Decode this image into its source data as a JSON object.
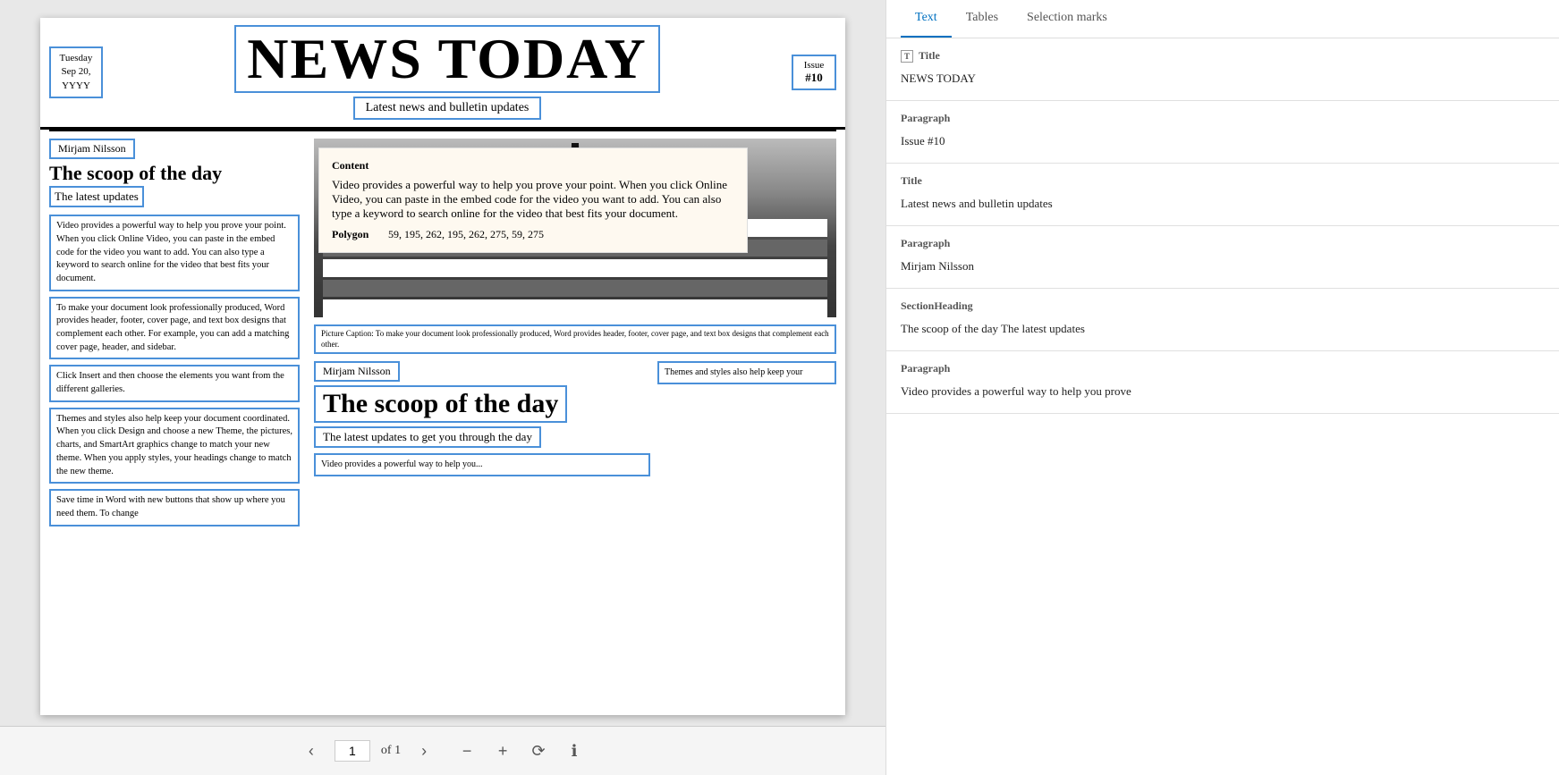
{
  "viewer": {
    "newspaper": {
      "date": "Tuesday\nSep 20,\nYYYY",
      "title": "NEWS TODAY",
      "subtitle": "Latest news and bulletin updates",
      "issue_label": "Issue",
      "issue_num": "#10"
    },
    "left_col": {
      "author": "Mirjam Nilsson",
      "heading": "The scoop of the day",
      "subheading": "The latest updates",
      "paragraphs": [
        "Video provides a powerful way to help you prove your point. When you click Online Video, you can paste in the embed code for the video you want to add. You can also type a keyword to search online for the video that best fits your document.",
        "To make your document look professionally produced, Word provides header, footer, cover page, and text box designs that complement each other. For example, you can add a matching cover page, header, and sidebar.",
        "Click Insert and then choose the elements you want from the different galleries.",
        "Themes and styles also help keep your document coordinated. When you click Design and choose a new Theme, the pictures, charts, and SmartArt graphics change to match your new theme. When you apply styles, your headings change to match the new theme.",
        "Save time in Word with new buttons that show up where you need them. To change"
      ]
    },
    "tooltip": {
      "label": "Content",
      "content": "Video provides a powerful way to help you prove your point. When you click Online Video, you can paste in the embed code for the video you want to add. You can also type a keyword to search online for the video that best fits your document.",
      "polygon_label": "Polygon",
      "polygon_value": "59, 195, 262, 195, 262, 275, 59, 275"
    },
    "picture_caption": "Picture Caption: To make your document look professionally produced, Word provides header, footer, cover page, and text box designs that complement each other.",
    "second_section": {
      "author": "Mirjam Nilsson",
      "heading": "The scoop of the day",
      "subheading": "The latest updates to get you through the day",
      "content_preview": "Video provides a powerful way to help you...",
      "right_preview": "Themes and styles also help keep your"
    }
  },
  "toolbar": {
    "prev_label": "‹",
    "next_label": "›",
    "page_num": "1",
    "page_of": "of 1",
    "zoom_out": "−",
    "zoom_in": "+",
    "rotate": "⟳",
    "info": "ℹ"
  },
  "right_panel": {
    "tabs": [
      {
        "id": "text",
        "label": "Text",
        "active": true
      },
      {
        "id": "tables",
        "label": "Tables",
        "active": false
      },
      {
        "id": "selection_marks",
        "label": "Selection marks",
        "active": false
      }
    ],
    "sections": [
      {
        "type": "Title",
        "label": "Title",
        "value": "NEWS TODAY"
      },
      {
        "type": "Paragraph",
        "label": "Paragraph",
        "value": "Issue #10"
      },
      {
        "type": "Title",
        "label": "Title",
        "value": "Latest news and bulletin updates"
      },
      {
        "type": "Paragraph",
        "label": "Paragraph",
        "value": "Mirjam Nilsson"
      },
      {
        "type": "SectionHeading",
        "label": "SectionHeading",
        "value": "The scoop of the day The latest updates"
      },
      {
        "type": "Paragraph",
        "label": "Paragraph",
        "value": "Video provides a powerful way to help you prove"
      }
    ]
  }
}
